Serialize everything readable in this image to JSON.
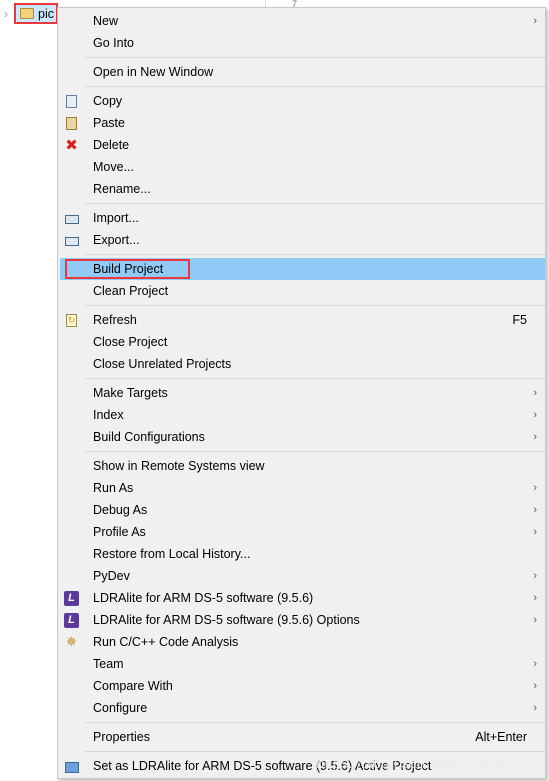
{
  "editor": {
    "line_number": "7"
  },
  "tree": {
    "project_name": "pic"
  },
  "menu": {
    "groups": [
      [
        {
          "label": "New",
          "submenu": true
        },
        {
          "label": "Go Into"
        }
      ],
      [
        {
          "label": "Open in New Window"
        }
      ],
      [
        {
          "label": "Copy",
          "icon": "copy-icon"
        },
        {
          "label": "Paste",
          "icon": "paste-icon"
        },
        {
          "label": "Delete",
          "icon": "delete-icon"
        },
        {
          "label": "Move..."
        },
        {
          "label": "Rename..."
        }
      ],
      [
        {
          "label": "Import...",
          "icon": "import-icon"
        },
        {
          "label": "Export...",
          "icon": "export-icon"
        }
      ],
      [
        {
          "label": "Build Project",
          "highlighted": true
        },
        {
          "label": "Clean Project"
        }
      ],
      [
        {
          "label": "Refresh",
          "icon": "refresh-icon",
          "shortcut": "F5"
        },
        {
          "label": "Close Project"
        },
        {
          "label": "Close Unrelated Projects"
        }
      ],
      [
        {
          "label": "Make Targets",
          "submenu": true
        },
        {
          "label": "Index",
          "submenu": true
        },
        {
          "label": "Build Configurations",
          "submenu": true
        }
      ],
      [
        {
          "label": "Show in Remote Systems view"
        },
        {
          "label": "Run As",
          "submenu": true
        },
        {
          "label": "Debug As",
          "submenu": true
        },
        {
          "label": "Profile As",
          "submenu": true
        },
        {
          "label": "Restore from Local History..."
        },
        {
          "label": "PyDev",
          "submenu": true
        },
        {
          "label": "LDRAlite for ARM DS-5 software (9.5.6)",
          "icon": "ldra-icon",
          "submenu": true
        },
        {
          "label": "LDRAlite for ARM DS-5 software (9.5.6) Options",
          "icon": "ldra-icon",
          "submenu": true
        },
        {
          "label": "Run C/C++ Code Analysis",
          "icon": "code-analysis-icon"
        },
        {
          "label": "Team",
          "submenu": true
        },
        {
          "label": "Compare With",
          "submenu": true
        },
        {
          "label": "Configure",
          "submenu": true
        }
      ],
      [
        {
          "label": "Properties",
          "shortcut": "Alt+Enter"
        }
      ],
      [
        {
          "label": "Set as LDRAlite for ARM DS-5 software (9.5.6) Active Project",
          "icon": "project-box-icon"
        }
      ]
    ]
  },
  "colors": {
    "highlight": "#91c9f7",
    "annotation_box": "#e8383d",
    "menu_bg": "#f0f0f0"
  },
  "watermark": "https://blog.csdn.net/ReCclay"
}
